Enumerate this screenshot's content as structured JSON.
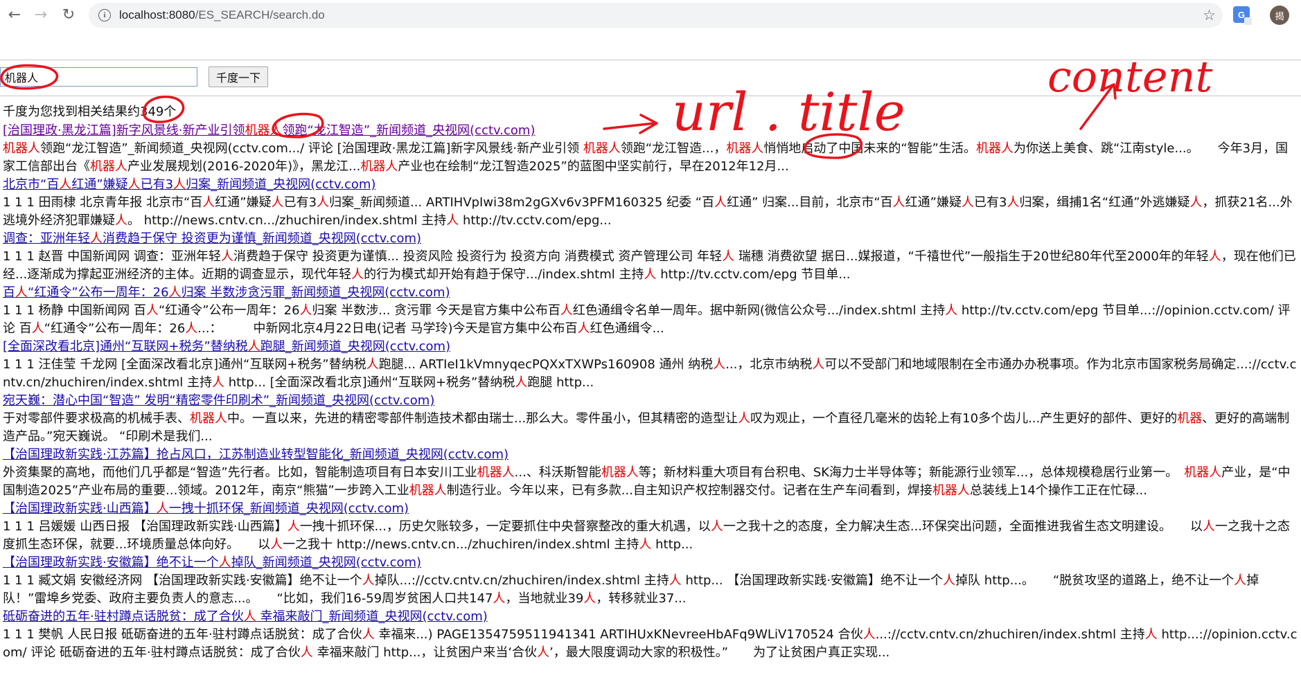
{
  "browser": {
    "url_host": "localhost:8080",
    "url_path": "/ES_SEARCH/search.do",
    "avatar_text": "揭",
    "ext_icon_text": "G"
  },
  "search": {
    "query": "机器人",
    "button_label": "千度一下"
  },
  "summary": "千度为您找到相关结果约349个",
  "results": [
    {
      "visited": true,
      "title": [
        {
          "t": "[治国理政·黑龙江篇]新字风景线·新产业引领"
        },
        {
          "t": "机器人",
          "h": true
        },
        {
          "t": "领跑“龙江智造”_新闻频道_央视网(cctv.com)"
        }
      ],
      "content": [
        {
          "t": "机器人",
          "h": true
        },
        {
          "t": "领跑“龙江智造”_新闻频道_央视网(cctv.com.../ 评论 [治国理政·黑龙江篇]新字风景线·新产业引领 "
        },
        {
          "t": "机器人",
          "h": true
        },
        {
          "t": "领跑“龙江智造...，"
        },
        {
          "t": "机器人",
          "h": true
        },
        {
          "t": "悄悄地启动了中国未来的“智能”生活。"
        },
        {
          "t": "机器人",
          "h": true
        },
        {
          "t": "为你送上美食、跳“江南style...。　　今年3月，国家工信部出台《"
        },
        {
          "t": "机器人",
          "h": true
        },
        {
          "t": "产业发展规划(2016-2020年)》，黑龙江..."
        },
        {
          "t": "机器人",
          "h": true
        },
        {
          "t": "产业也在绘制“龙江智造2025”的蓝图中坚实前行，早在2012年12月..."
        }
      ]
    },
    {
      "visited": false,
      "title": [
        {
          "t": "北京市“百"
        },
        {
          "t": "人",
          "h": true
        },
        {
          "t": "红通”嫌疑"
        },
        {
          "t": "人",
          "h": true
        },
        {
          "t": "已有3"
        },
        {
          "t": "人",
          "h": true
        },
        {
          "t": "归案_新闻频道_央视网(cctv.com)"
        }
      ],
      "content": [
        {
          "t": "1 1 1 田雨棣 北京青年报 北京市“百"
        },
        {
          "t": "人",
          "h": true
        },
        {
          "t": "红通”嫌疑"
        },
        {
          "t": "人",
          "h": true
        },
        {
          "t": "已有3"
        },
        {
          "t": "人",
          "h": true
        },
        {
          "t": "归案_新闻频道... ARTIHVpIwi38m2gGXv6v3PFM160325 纪委 “百"
        },
        {
          "t": "人",
          "h": true
        },
        {
          "t": "红通” 归案...目前，北京市“百"
        },
        {
          "t": "人",
          "h": true
        },
        {
          "t": "红通”嫌疑"
        },
        {
          "t": "人",
          "h": true
        },
        {
          "t": "已有3"
        },
        {
          "t": "人",
          "h": true
        },
        {
          "t": "归案，缉捕1名“红通”外逃嫌疑"
        },
        {
          "t": "人",
          "h": true
        },
        {
          "t": "，抓获21名...外逃境外经济犯罪嫌疑"
        },
        {
          "t": "人",
          "h": true
        },
        {
          "t": "。 http://news.cntv.cn.../zhuchiren/index.shtml 主持"
        },
        {
          "t": "人",
          "h": true
        },
        {
          "t": " http://tv.cctv.com/epg..."
        }
      ]
    },
    {
      "visited": false,
      "title": [
        {
          "t": "调查：亚洲年轻"
        },
        {
          "t": "人",
          "h": true
        },
        {
          "t": "消费趋于保守 投资更为谨慎_新闻频道_央视网(cctv.com)"
        }
      ],
      "content": [
        {
          "t": "1 1 1 赵晋 中国新闻网 调查：亚洲年轻"
        },
        {
          "t": "人",
          "h": true
        },
        {
          "t": "消费趋于保守 投资更为谨慎... 投资风险 投资行为 投资方向 消费模式 资产管理公司 年轻"
        },
        {
          "t": "人",
          "h": true
        },
        {
          "t": " 瑞穗 消费欲望 据日...媒报道，“千禧世代”一般指生于20世纪80年代至2000年的年轻"
        },
        {
          "t": "人",
          "h": true
        },
        {
          "t": "，现在他们已经...逐渐成为撑起亚洲经济的主体。近期的调查显示，现代年轻"
        },
        {
          "t": "人",
          "h": true
        },
        {
          "t": "的行为模式却开始有趋于保守.../index.shtml 主持"
        },
        {
          "t": "人",
          "h": true
        },
        {
          "t": " http://tv.cctv.com/epg 节目单..."
        }
      ]
    },
    {
      "visited": false,
      "title": [
        {
          "t": "百"
        },
        {
          "t": "人",
          "h": true
        },
        {
          "t": "“红通令”公布一周年：26"
        },
        {
          "t": "人",
          "h": true
        },
        {
          "t": "归案 半数涉贪污罪_新闻频道_央视网(cctv.com)"
        }
      ],
      "content": [
        {
          "t": "1 1 1 杨静 中国新闻网 百"
        },
        {
          "t": "人",
          "h": true
        },
        {
          "t": "“红通令”公布一周年：26"
        },
        {
          "t": "人",
          "h": true
        },
        {
          "t": "归案 半数涉... 贪污罪 今天是官方集中公布百"
        },
        {
          "t": "人",
          "h": true
        },
        {
          "t": "红色通缉令名单一周年。据中新网(微信公众号.../index.shtml 主持"
        },
        {
          "t": "人",
          "h": true
        },
        {
          "t": " http://tv.cctv.com/epg 节目单...://opinion.cctv.com/ 评论 百"
        },
        {
          "t": "人",
          "h": true
        },
        {
          "t": "“红通令”公布一周年：26"
        },
        {
          "t": "人",
          "h": true
        },
        {
          "t": "...：　　　中新网北京4月22日电(记者 马学玲)今天是官方集中公布百"
        },
        {
          "t": "人",
          "h": true
        },
        {
          "t": "红色通缉令..."
        }
      ]
    },
    {
      "visited": false,
      "title": [
        {
          "t": "[全面深改看北京]通州“互联网+税务”替纳税"
        },
        {
          "t": "人",
          "h": true
        },
        {
          "t": "跑腿_新闻频道_央视网(cctv.com)"
        }
      ],
      "content": [
        {
          "t": "1 1 1 汪佳莹 千龙网 [全面深改看北京]通州“互联网+税务”替纳税"
        },
        {
          "t": "人",
          "h": true
        },
        {
          "t": "跑腿... ARTIeI1kVmnyqecPQXxTXWPs160908 通州 纳税"
        },
        {
          "t": "人",
          "h": true
        },
        {
          "t": "...，北京市纳税"
        },
        {
          "t": "人",
          "h": true
        },
        {
          "t": "可以不受部门和地域限制在全市通办办税事项。作为北京市国家税务局确定...://cctv.cntv.cn/zhuchiren/index.shtml 主持"
        },
        {
          "t": "人",
          "h": true
        },
        {
          "t": " http... [全面深改看北京]通州“互联网+税务”替纳税"
        },
        {
          "t": "人",
          "h": true
        },
        {
          "t": "跑腿 http..."
        }
      ]
    },
    {
      "visited": false,
      "title": [
        {
          "t": "宛天巍：潜心中国“智造” 发明“精密零件印刷术”_新闻频道_央视网(cctv.com)"
        }
      ],
      "content": [
        {
          "t": "于对零部件要求极高的机械手表、"
        },
        {
          "t": "机器人",
          "h": true
        },
        {
          "t": "中。一直以来，先进的精密零部件制造技术都由瑞士...那么大。零件虽小，但其精密的造型让"
        },
        {
          "t": "人",
          "h": true
        },
        {
          "t": "叹为观止，一个直径几毫米的齿轮上有10多个齿儿...产生更好的部件、更好的"
        },
        {
          "t": "机器",
          "h": true
        },
        {
          "t": "、更好的高端制造产品。”宛天巍说。 “印刷术是我们..."
        }
      ]
    },
    {
      "visited": false,
      "tall": true,
      "title": [
        {
          "t": "【治国理政新实践·江苏篇】抢占风口，江苏制造业转型智能化_新闻频道_央视网(cctv.com)"
        }
      ],
      "content": [
        {
          "t": "外资集聚的高地，而他们几乎都是“智造”先行者。比如，智能制造项目有日本安川工业"
        },
        {
          "t": "机器人",
          "h": true
        },
        {
          "t": "...、科沃斯智能"
        },
        {
          "t": "机器人",
          "h": true
        },
        {
          "t": "等；新材料重大项目有台积电、SK海力士半导体等；新能源行业领军...，总体规模稳居行业第一。　"
        },
        {
          "t": "机器人",
          "h": true
        },
        {
          "t": "产业，是“中国制造2025”产业布局的重要...领域。2012年，南京“熊猫”一步跨入工业"
        },
        {
          "t": "机器人",
          "h": true
        },
        {
          "t": "制造行业。今年以来，已有多款...自主知识产权控制器交付。记者在生产车间看到，焊接"
        },
        {
          "t": "机器人",
          "h": true
        },
        {
          "t": "总装线上14个操作工正在忙碌..."
        }
      ]
    },
    {
      "visited": false,
      "title": [
        {
          "t": "【治国理政新实践·山西篇】"
        },
        {
          "t": "人",
          "h": true
        },
        {
          "t": "一拽十抓环保_新闻频道_央视网(cctv.com)"
        }
      ],
      "content": [
        {
          "t": "1 1 1 吕媛媛 山西日报 【治国理政新实践·山西篇】"
        },
        {
          "t": "人",
          "h": true
        },
        {
          "t": "一拽十抓环保...，历史欠账较多，一定要抓住中央督察整改的重大机遇，以"
        },
        {
          "t": "人",
          "h": true
        },
        {
          "t": "一之我十之的态度，全力解决生态...环保突出问题，全面推进我省生态文明建设。　　以"
        },
        {
          "t": "人",
          "h": true
        },
        {
          "t": "一之我十之态度抓生态环保，就要...环境质量总体向好。　　以"
        },
        {
          "t": "人",
          "h": true
        },
        {
          "t": "一之我十 http://news.cntv.cn.../zhuchiren/index.shtml 主持"
        },
        {
          "t": "人",
          "h": true
        },
        {
          "t": " http..."
        }
      ]
    },
    {
      "visited": false,
      "title": [
        {
          "t": "【治国理政新实践·安徽篇】绝不让一个"
        },
        {
          "t": "人",
          "h": true
        },
        {
          "t": "掉队_新闻频道_央视网(cctv.com)"
        }
      ],
      "content": [
        {
          "t": "1 1 1 臧文娟 安徽经济网 【治国理政新实践·安徽篇】绝不让一个"
        },
        {
          "t": "人",
          "h": true
        },
        {
          "t": "掉队...://cctv.cntv.cn/zhuchiren/index.shtml 主持"
        },
        {
          "t": "人",
          "h": true
        },
        {
          "t": " http... 【治国理政新实践·安徽篇】绝不让一个"
        },
        {
          "t": "人",
          "h": true
        },
        {
          "t": "掉队 http...。　　“脱贫攻坚的道路上，绝不让一个"
        },
        {
          "t": "人",
          "h": true
        },
        {
          "t": "掉队！”雷埠乡党委、政府主要负责人的意志...。　　“比如，我们16-59周岁贫困人口共147"
        },
        {
          "t": "人",
          "h": true
        },
        {
          "t": "，当地就业39"
        },
        {
          "t": "人",
          "h": true
        },
        {
          "t": "，转移就业37..."
        }
      ]
    },
    {
      "visited": false,
      "title": [
        {
          "t": "砥砺奋进的五年·驻村蹲点话脱贫：成了合伙"
        },
        {
          "t": "人",
          "h": true
        },
        {
          "t": " 幸福来敲门_新闻频道_央视网(cctv.com)"
        }
      ],
      "content": [
        {
          "t": "1 1 1 樊帆 人民日报 砥砺奋进的五年·驻村蹲点话脱贫：成了合伙"
        },
        {
          "t": "人",
          "h": true
        },
        {
          "t": " 幸福来...) PAGE1354759511941341 ARTIHUxKNevreeHbAFq9WLiV170524 合伙"
        },
        {
          "t": "人",
          "h": true
        },
        {
          "t": "...://cctv.cntv.cn/zhuchiren/index.shtml 主持"
        },
        {
          "t": "人",
          "h": true
        },
        {
          "t": " http...://opinion.cctv.com/ 评论 砥砺奋进的五年·驻村蹲点话脱贫：成了合伙"
        },
        {
          "t": "人",
          "h": true
        },
        {
          "t": " 幸福来敲门 http...，让贫困户来当‘合伙"
        },
        {
          "t": "人",
          "h": true
        },
        {
          "t": "’，最大限度调动大家的积极性。”　　为了让贫困户真正实现..."
        }
      ]
    }
  ],
  "annotations": {
    "url_title": "url . title",
    "content": "content"
  },
  "colors": {
    "link": "#1a0dab",
    "visited": "#660099",
    "highlight": "#e00000",
    "annotation": "#e8141c"
  }
}
